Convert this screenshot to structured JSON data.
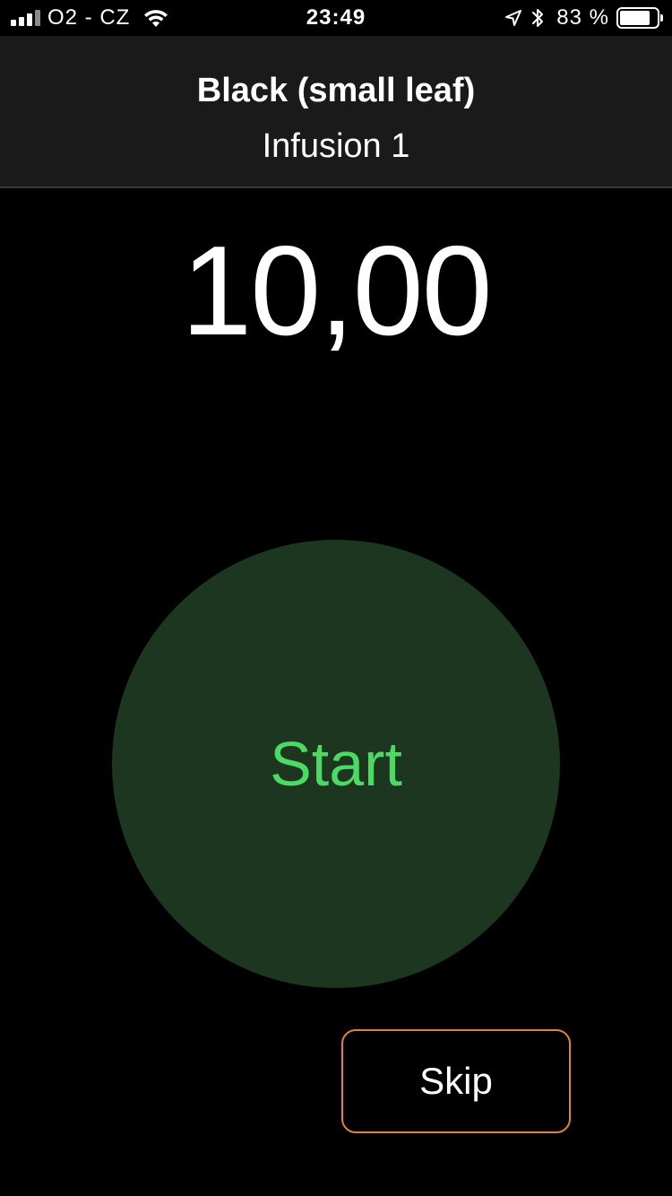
{
  "status_bar": {
    "carrier": "O2 - CZ",
    "time": "23:49",
    "battery_percent_label": "83 %",
    "battery_level": 0.83,
    "icons": [
      "signal-icon",
      "wifi-icon",
      "location-icon",
      "bluetooth-icon",
      "battery-icon"
    ]
  },
  "header": {
    "title": "Black (small leaf)",
    "subtitle": "Infusion 1"
  },
  "timer": {
    "value": "10,00"
  },
  "actions": {
    "start_label": "Start",
    "skip_label": "Skip"
  },
  "colors": {
    "background": "#000000",
    "header_background": "#1a1a1a",
    "start_button_fill": "#1c3620",
    "start_label": "#4cd964",
    "skip_border": "#e0823d"
  }
}
